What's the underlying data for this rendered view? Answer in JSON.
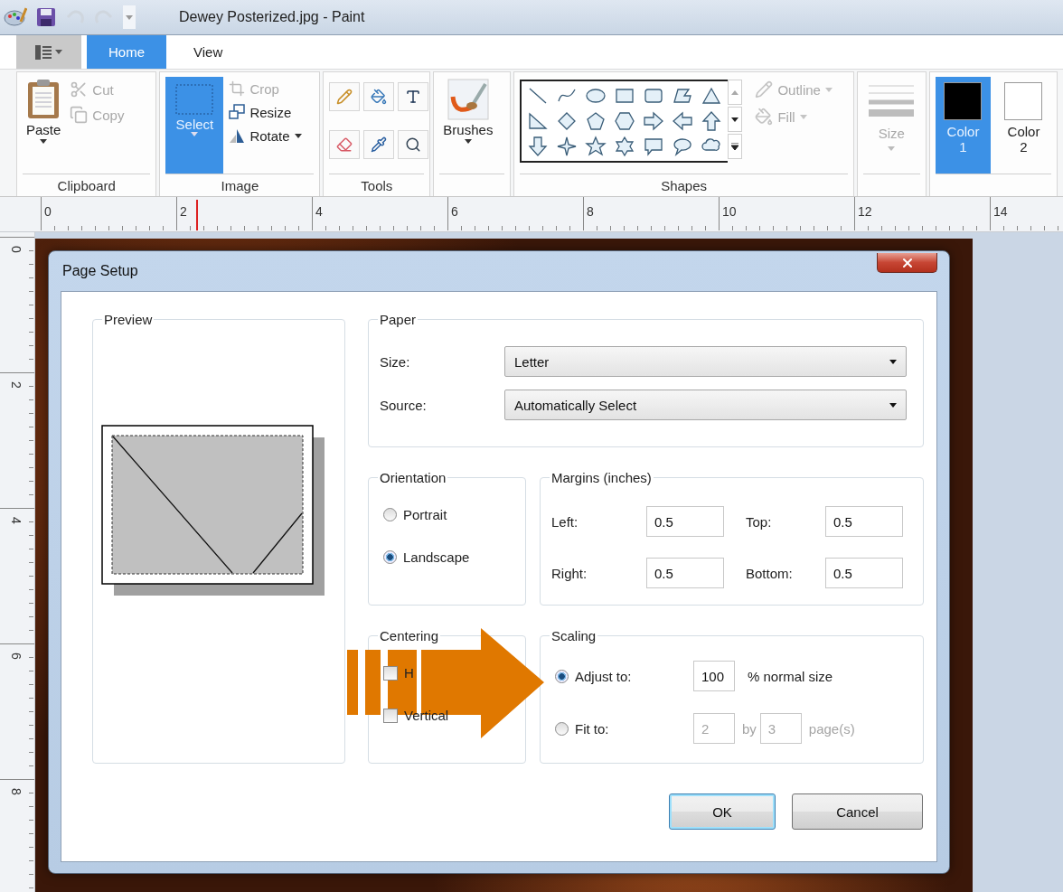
{
  "window": {
    "title": "Dewey Posterized.jpg - Paint"
  },
  "ribbon_tabs": [
    {
      "label": "Home",
      "selected": true
    },
    {
      "label": "View",
      "selected": false
    }
  ],
  "clipboard": {
    "title": "Clipboard",
    "paste": "Paste",
    "items": [
      {
        "label": "Cut",
        "disabled": true
      },
      {
        "label": "Copy",
        "disabled": true
      }
    ]
  },
  "image": {
    "title": "Image",
    "select": {
      "label": "Select",
      "selected": true
    },
    "items": [
      {
        "label": "Crop",
        "disabled": true,
        "dropdown": false
      },
      {
        "label": "Resize",
        "disabled": false,
        "dropdown": false
      },
      {
        "label": "Rotate",
        "disabled": false,
        "dropdown": true
      }
    ]
  },
  "tools": {
    "title": "Tools"
  },
  "brushes": {
    "label": "Brushes"
  },
  "shapes": {
    "title": "Shapes",
    "options": [
      {
        "label": "Outline",
        "disabled": true
      },
      {
        "label": "Fill",
        "disabled": true
      }
    ]
  },
  "size": {
    "label": "Size",
    "disabled": true
  },
  "colors": [
    {
      "label": "Color",
      "number": "1",
      "selected": true,
      "color": "#000000"
    },
    {
      "label": "Color",
      "number": "2",
      "selected": false,
      "color": "#ffffff"
    }
  ],
  "ruler": {
    "horizontal": [
      "0",
      "2",
      "4",
      "6",
      "8",
      "10",
      "12",
      "14"
    ],
    "vertical": [
      "0",
      "2",
      "4",
      "6",
      "8"
    ]
  },
  "dialog": {
    "title": "Page Setup",
    "preview": {
      "title": "Preview"
    },
    "paper": {
      "title": "Paper",
      "fields": [
        {
          "label": "Size:",
          "value": "Letter"
        },
        {
          "label": "Source:",
          "value": "Automatically Select"
        }
      ]
    },
    "orientation": {
      "title": "Orientation",
      "options": [
        {
          "label": "Portrait",
          "selected": false
        },
        {
          "label": "Landscape",
          "selected": true
        }
      ]
    },
    "margins": {
      "title": "Margins (inches)",
      "fields": [
        {
          "label": "Left:",
          "value": "0.5"
        },
        {
          "label": "Top:",
          "value": "0.5"
        },
        {
          "label": "Right:",
          "value": "0.5"
        },
        {
          "label": "Bottom:",
          "value": "0.5"
        }
      ]
    },
    "centering": {
      "title": "Centering",
      "options": [
        {
          "label": "H",
          "checked": false
        },
        {
          "label": "Vertical",
          "checked": false
        }
      ]
    },
    "scaling": {
      "title": "Scaling",
      "options": [
        {
          "kind": "adjust",
          "label": "Adjust to:",
          "selected": true,
          "disabled": false,
          "values": [
            "100"
          ],
          "suffix": "% normal size"
        },
        {
          "kind": "fit",
          "label": "Fit to:",
          "selected": false,
          "disabled": true,
          "values": [
            "2",
            "3"
          ],
          "between": "by",
          "suffix": "page(s)"
        }
      ]
    },
    "buttons": [
      {
        "label": "OK",
        "default": true
      },
      {
        "label": "Cancel",
        "default": false
      }
    ]
  }
}
